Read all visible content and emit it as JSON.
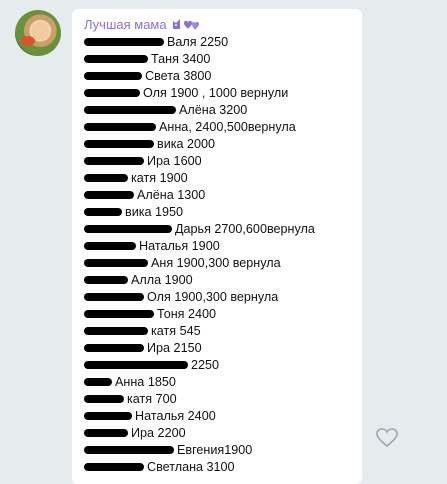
{
  "message": {
    "author": "Лучшая мама",
    "author_reaction_icon": "cat-hearts-emoji-icon",
    "lines": [
      {
        "text": "Валя 2250",
        "redact_w": 80
      },
      {
        "text": "Таня 3400",
        "redact_w": 64
      },
      {
        "text": "Света 3800",
        "redact_w": 58
      },
      {
        "text": "Оля 1900 , 1000 вернули",
        "redact_w": 56
      },
      {
        "text": "Алёна 3200",
        "redact_w": 92
      },
      {
        "text": "Анна,  2400,500вернула",
        "redact_w": 72
      },
      {
        "text": "вика 2000",
        "redact_w": 70
      },
      {
        "text": "Ира 1600",
        "redact_w": 60
      },
      {
        "text": "катя 1900",
        "redact_w": 44
      },
      {
        "text": "Алёна 1300",
        "redact_w": 50
      },
      {
        "text": "вика 1950",
        "redact_w": 38
      },
      {
        "text": "Дарья 2700,600вернула",
        "redact_w": 88
      },
      {
        "text": "Наталья 1900",
        "redact_w": 52
      },
      {
        "text": "Аня 1900,300 вернула",
        "redact_w": 64
      },
      {
        "text": "Алла 1900",
        "redact_w": 44
      },
      {
        "text": "Оля 1900,300 вернула",
        "redact_w": 60
      },
      {
        "text": "Тоня 2400",
        "redact_w": 70
      },
      {
        "text": "катя 545",
        "redact_w": 64
      },
      {
        "text": "Ира 2150",
        "redact_w": 60
      },
      {
        "text": "2250",
        "redact_w": 104
      },
      {
        "text": "Анна 1850",
        "redact_w": 28
      },
      {
        "text": "катя 700",
        "redact_w": 40
      },
      {
        "text": "Наталья 2400",
        "redact_w": 48
      },
      {
        "text": "Ира 2200",
        "redact_w": 44
      },
      {
        "text": "Евгения1900",
        "redact_w": 90
      },
      {
        "text": "Светлана 3100",
        "redact_w": 60
      }
    ]
  },
  "like_icon": "heart-outline-icon",
  "colors": {
    "background": "#e6ebee",
    "bubble": "#ffffff",
    "author": "#8b72cf",
    "text": "#111111"
  }
}
